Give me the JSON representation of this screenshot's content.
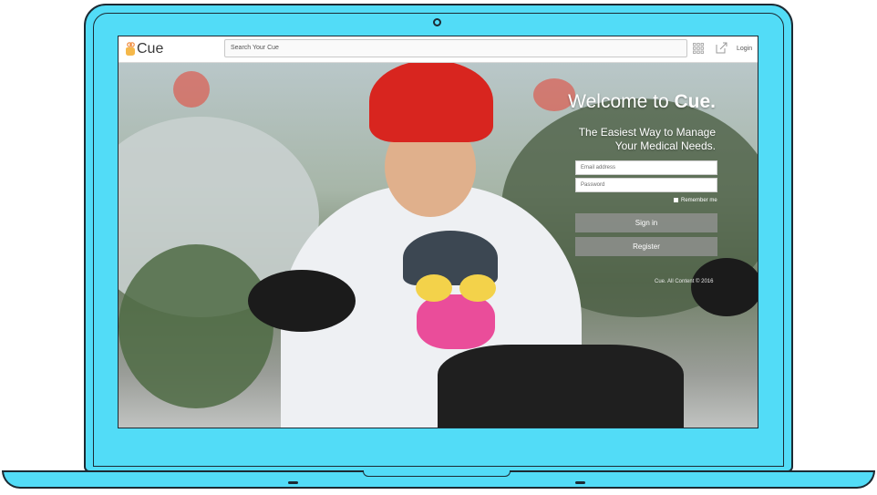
{
  "app": {
    "name": "Cue",
    "accent": "#f5b84a",
    "laptop_color": "#52dcf7"
  },
  "header": {
    "search_placeholder": "Search Your Cue",
    "login_label": "Login",
    "icons": [
      "apps-grid-icon",
      "share-icon"
    ]
  },
  "hero": {
    "welcome_prefix": "Welcome to ",
    "welcome_brand": "Cue.",
    "tagline_line1": "The Easiest Way to Manage",
    "tagline_line2": "Your Medical Needs."
  },
  "form": {
    "email_placeholder": "Email address",
    "password_placeholder": "Password",
    "remember_label": "Remember me",
    "sign_in_label": "Sign in",
    "register_label": "Register"
  },
  "footer": {
    "copyright": "Cue. All Content © 2016"
  }
}
